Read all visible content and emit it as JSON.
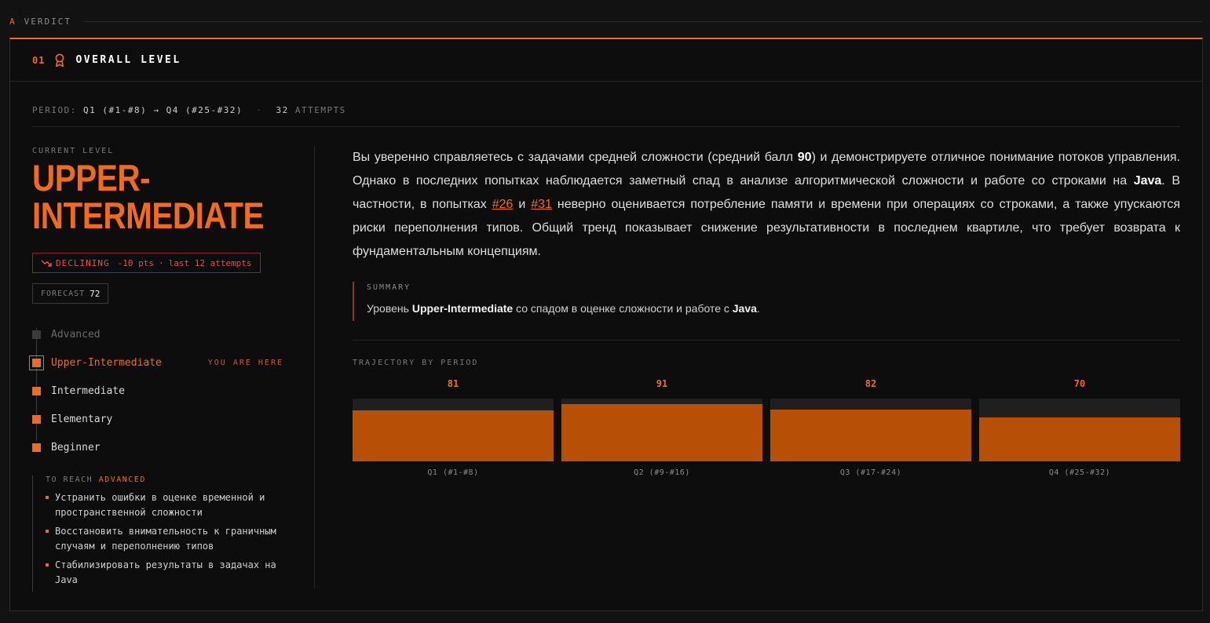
{
  "section": {
    "letter": "A",
    "label": "VERDICT"
  },
  "header": {
    "number": "01",
    "title": "OVERALL LEVEL",
    "icon": "award-icon"
  },
  "period": {
    "label": "PERIOD:",
    "from": "Q1 (#1-#8)",
    "arrow": "→",
    "to": "Q4 (#25-#32)",
    "separator": "·",
    "attempts_count": "32",
    "attempts_label": "ATTEMPTS"
  },
  "current": {
    "label": "CURRENT LEVEL",
    "level_line1": "UPPER-",
    "level_line2": "INTERMEDIATE"
  },
  "trend": {
    "icon": "trending-down-icon",
    "label": "DECLINING",
    "delta": "-10 pts",
    "separator": "·",
    "window": "last 12 attempts",
    "color": "#ef4b4b"
  },
  "forecast": {
    "label": "FORECAST",
    "value": "72"
  },
  "ladder": {
    "you_are_here": "YOU ARE HERE",
    "levels": [
      {
        "label": "Advanced",
        "state": "locked"
      },
      {
        "label": "Upper-Intermediate",
        "state": "current"
      },
      {
        "label": "Intermediate",
        "state": "done"
      },
      {
        "label": "Elementary",
        "state": "done"
      },
      {
        "label": "Beginner",
        "state": "done"
      }
    ]
  },
  "reach": {
    "prefix": "TO REACH",
    "target": "ADVANCED",
    "items": [
      "Устранить ошибки в оценке временной и пространственной сложности",
      "Восстановить внимательность к граничным случаям и переполнению типов",
      "Стабилизировать результаты в задачах на Java"
    ]
  },
  "analysis": {
    "p1": "Вы уверенно справляетесь с задачами средней сложности (средний балл ",
    "score": "90",
    "p2": ") и демонстрируете отличное понимание потоков управления. Однако в последних попытках наблюдается заметный спад в анализе алгоритмической сложности и работе со строками на ",
    "lang": "Java",
    "p3": ". В частности, в попытках ",
    "ref1": "#26",
    "p4": " и ",
    "ref2": "#31",
    "p5": " неверно оценивается потребление памяти и времени при операциях со строками, а также упускаются риски переполнения типов. Общий тренд показывает снижение результативности в последнем квартиле, что требует возврата к фундаментальным концепциям."
  },
  "summary": {
    "label": "SUMMARY",
    "t1": "Уровень ",
    "level": "Upper-Intermediate",
    "t2": " со спадом в оценке сложности и работе с ",
    "lang": "Java",
    "t3": "."
  },
  "trajectory_label": "TRAJECTORY BY PERIOD",
  "chart_data": {
    "type": "bar",
    "title": "TRAJECTORY BY PERIOD",
    "categories": [
      "Q1 (#1-#8)",
      "Q2 (#9-#16)",
      "Q3 (#17-#24)",
      "Q4 (#25-#32)"
    ],
    "values": [
      81,
      91,
      82,
      70
    ],
    "ylim": [
      0,
      100
    ],
    "grid": false,
    "bar_color": "#b84f06",
    "label_color": "#f26b1d"
  },
  "colors": {
    "accent": "#f26b1d",
    "bar": "#b84f06",
    "declining": "#ef4b4b"
  }
}
